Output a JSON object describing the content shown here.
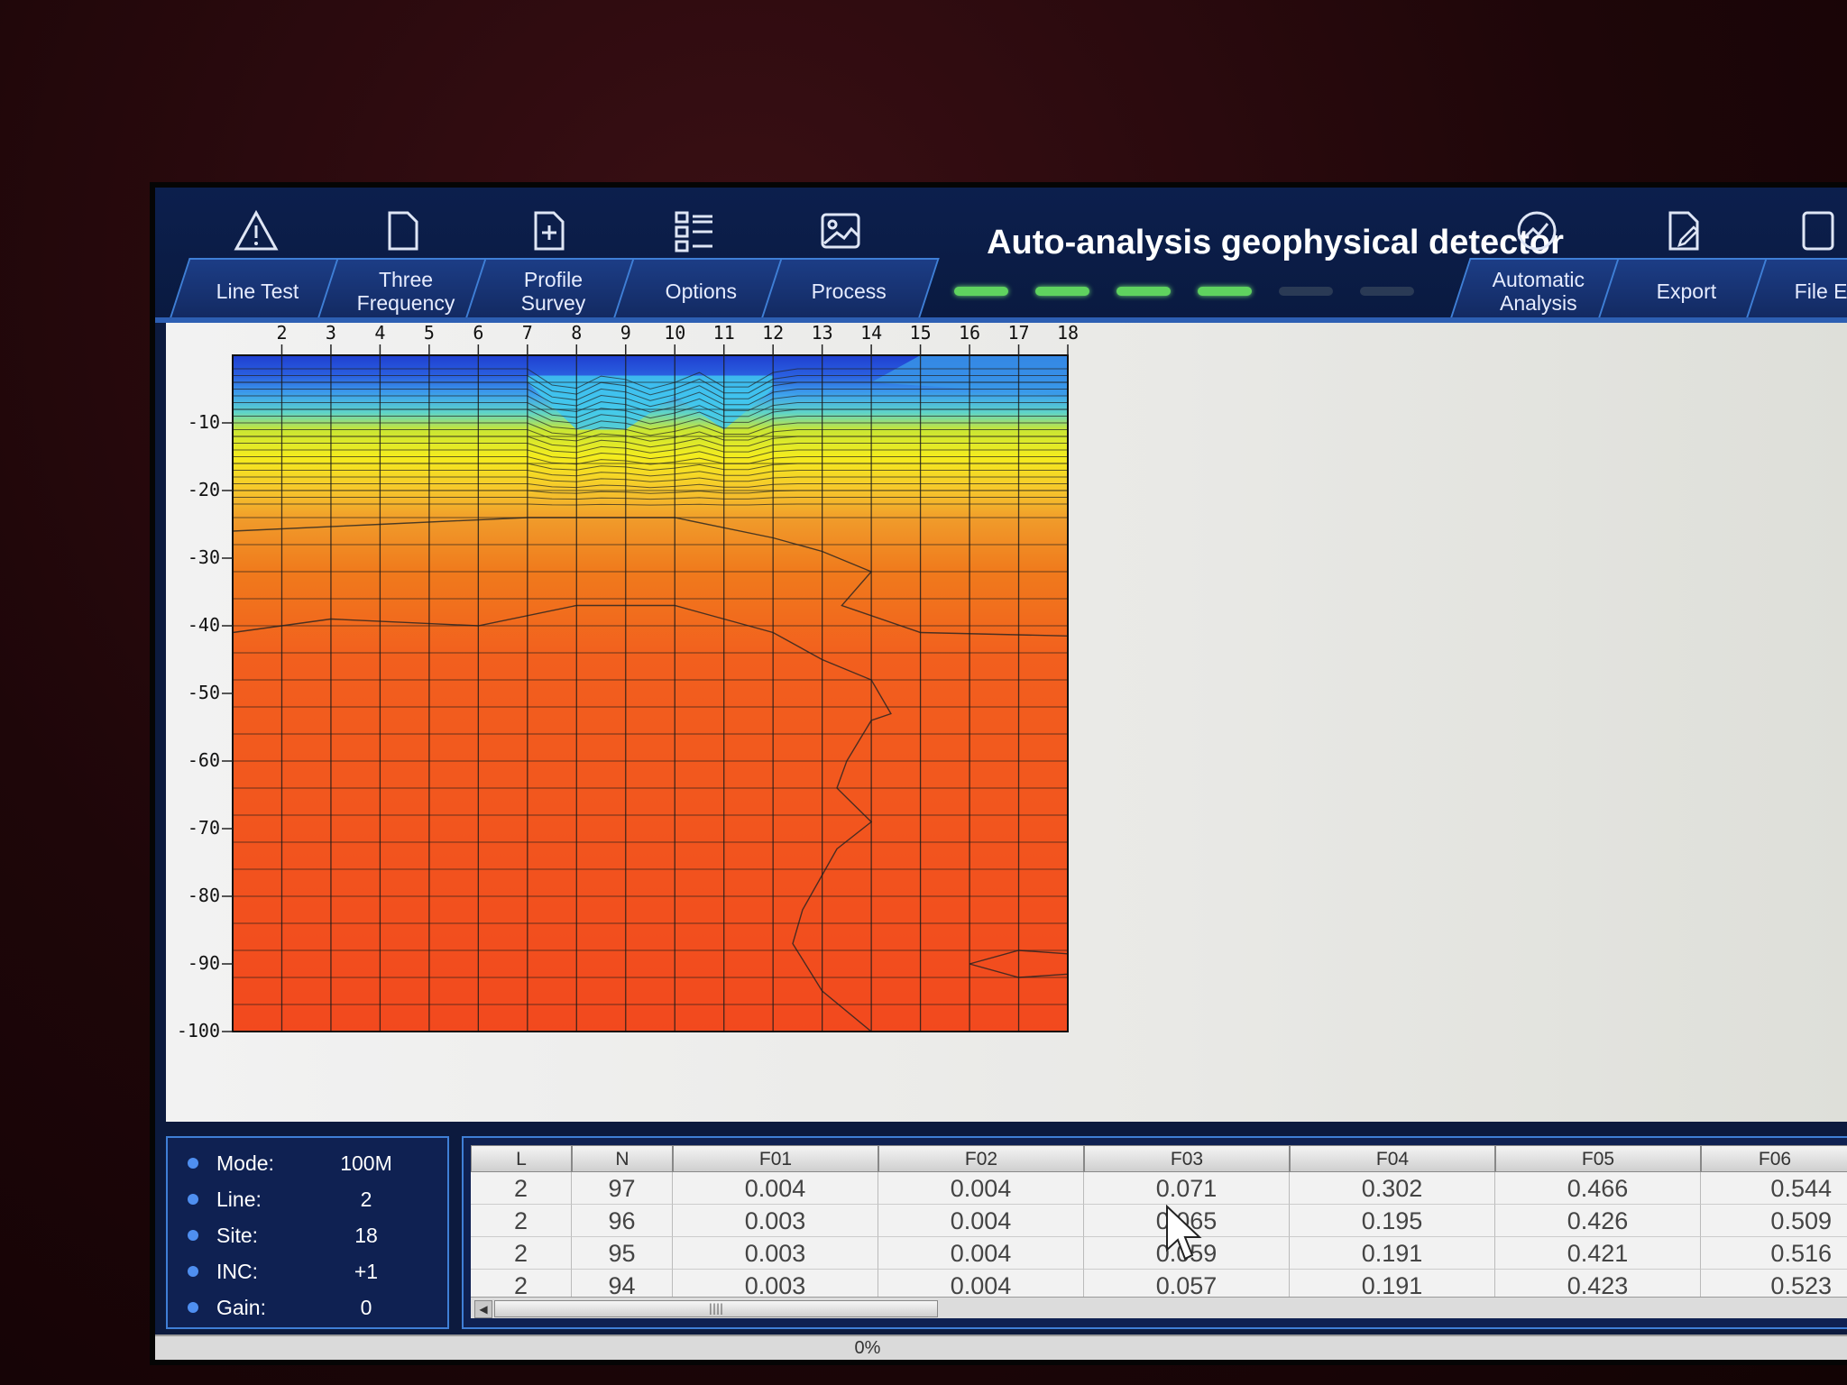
{
  "app": {
    "title": "Auto-analysis geophysical detector"
  },
  "toolbar_icons": [
    "warning-icon",
    "document-icon",
    "new-document-icon",
    "list-icon",
    "image-icon",
    "chart-icon",
    "edit-document-icon",
    "file-icon"
  ],
  "tabs": [
    {
      "label": "Line Test"
    },
    {
      "label": "Three\nFrequency"
    },
    {
      "label": "Profile\nSurvey"
    },
    {
      "label": "Options"
    },
    {
      "label": "Process"
    },
    {
      "label": "Automatic\nAnalysis"
    },
    {
      "label": "Export"
    },
    {
      "label": "File Expl"
    }
  ],
  "leds": {
    "on": 4,
    "total": 6
  },
  "chart_data": {
    "type": "heatmap",
    "x_ticks": [
      2,
      3,
      4,
      5,
      6,
      7,
      8,
      9,
      10,
      11,
      12,
      13,
      14,
      15,
      16,
      17,
      18
    ],
    "y_ticks": [
      -10,
      -20,
      -30,
      -40,
      -50,
      -60,
      -70,
      -80,
      -90,
      -100
    ],
    "xlim": [
      1,
      18
    ],
    "ylim": [
      -100,
      0
    ],
    "colors": {
      "deep_blue": "#1f3fd0",
      "cyan": "#41c8ee",
      "yellow": "#f4ec1e",
      "orange": "#f07a1c",
      "red_orange": "#f2491e"
    }
  },
  "info_panel": {
    "rows": [
      {
        "label": "Mode:",
        "value": "100M"
      },
      {
        "label": "Line:",
        "value": "2"
      },
      {
        "label": "Site:",
        "value": "18"
      },
      {
        "label": "INC:",
        "value": "+1"
      },
      {
        "label": "Gain:",
        "value": "0"
      }
    ]
  },
  "table": {
    "headers": [
      "L",
      "N",
      "F01",
      "F02",
      "F03",
      "F04",
      "F05",
      "F06"
    ],
    "rows": [
      [
        "2",
        "97",
        "0.004",
        "0.004",
        "0.071",
        "0.302",
        "0.466",
        "0.544"
      ],
      [
        "2",
        "96",
        "0.003",
        "0.004",
        "0.065",
        "0.195",
        "0.426",
        "0.509"
      ],
      [
        "2",
        "95",
        "0.003",
        "0.004",
        "0.059",
        "0.191",
        "0.421",
        "0.516"
      ],
      [
        "2",
        "94",
        "0.003",
        "0.004",
        "0.057",
        "0.191",
        "0.423",
        "0.523"
      ]
    ]
  },
  "progress": {
    "label": "0%",
    "value": 0
  }
}
